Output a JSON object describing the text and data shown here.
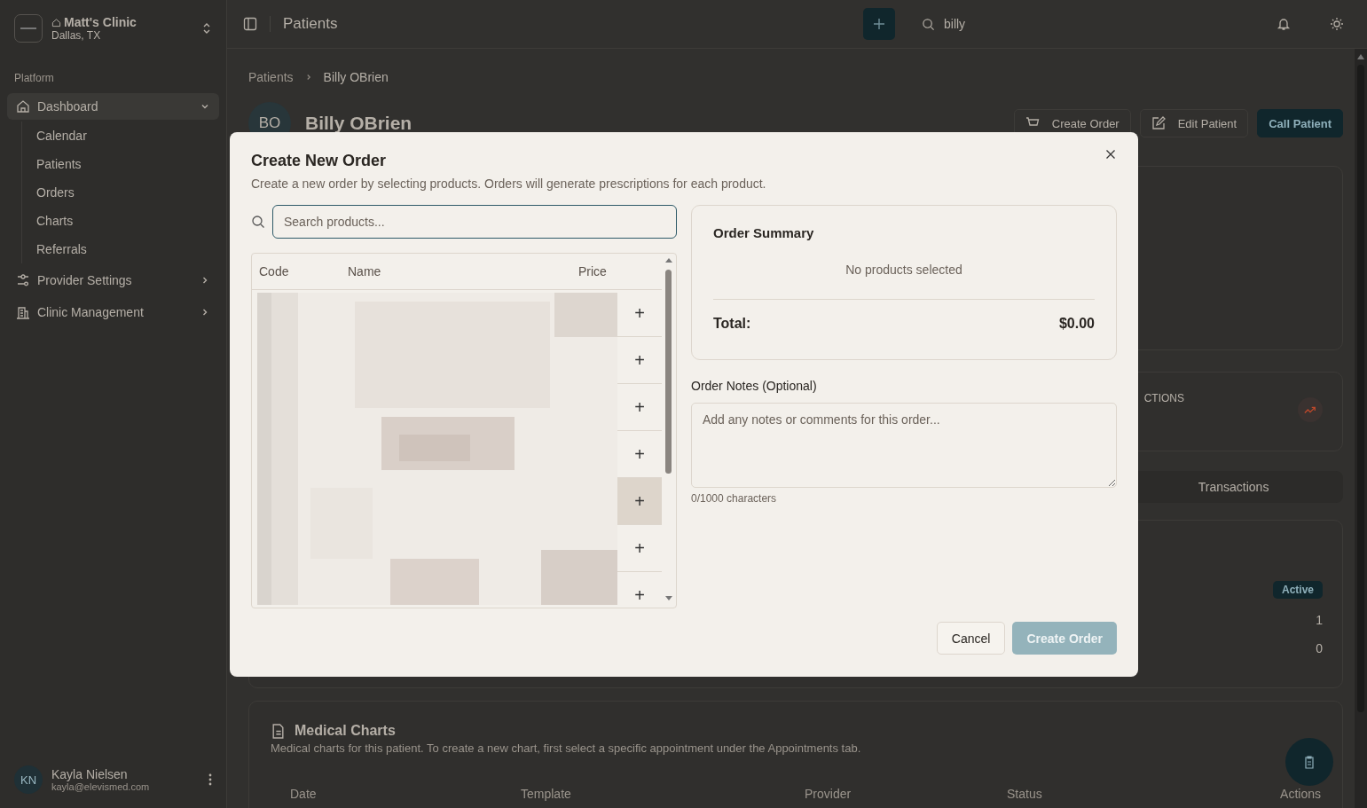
{
  "sidebar": {
    "clinic": {
      "name": "Matt's Clinic",
      "location": "Dallas, TX"
    },
    "section_label": "Platform",
    "nav": [
      {
        "label": "Dashboard",
        "kind": "home",
        "expanded": true,
        "selected": true,
        "children": [
          {
            "label": "Calendar"
          },
          {
            "label": "Patients"
          },
          {
            "label": "Orders"
          },
          {
            "label": "Charts"
          },
          {
            "label": "Referrals"
          }
        ]
      },
      {
        "label": "Provider Settings",
        "kind": "sliders",
        "expanded": false,
        "selected": false
      },
      {
        "label": "Clinic Management",
        "kind": "building",
        "expanded": false,
        "selected": false
      }
    ],
    "user": {
      "initials": "KN",
      "name": "Kayla Nielsen",
      "email": "kayla@elevismed.com"
    }
  },
  "header": {
    "title": "Patients",
    "search": {
      "value": "billy"
    }
  },
  "breadcrumb": [
    "Patients",
    "Billy OBrien"
  ],
  "patient": {
    "initials": "BO",
    "name": "Billy OBrien",
    "actions": [
      {
        "label": "Create Order",
        "kind": "cart"
      },
      {
        "label": "Edit Patient",
        "kind": "edit"
      },
      {
        "label": "Call Patient",
        "kind": "primary"
      }
    ]
  },
  "background": {
    "stat_label": "CTIONS",
    "tab": "Transactions",
    "status_badge": "Active",
    "values": [
      "1",
      "0"
    ]
  },
  "medical_charts": {
    "title": "Medical Charts",
    "description": "Medical charts for this patient. To create a new chart, first select a specific appointment under the Appointments tab.",
    "columns": [
      "Date",
      "Template",
      "Provider",
      "Status",
      "Actions"
    ]
  },
  "dialog": {
    "title": "Create New Order",
    "description": "Create a new order by selecting products. Orders will generate prescriptions for each product.",
    "search": {
      "placeholder": "Search products..."
    },
    "columns": [
      "Code",
      "Name",
      "Price"
    ],
    "rows": [
      {
        "add": "+",
        "highlighted": false
      },
      {
        "add": "+",
        "highlighted": false
      },
      {
        "add": "+",
        "highlighted": false
      },
      {
        "add": "+",
        "highlighted": false
      },
      {
        "add": "+",
        "highlighted": true
      },
      {
        "add": "+",
        "highlighted": false
      },
      {
        "add": "+",
        "highlighted": false
      }
    ],
    "summary": {
      "title": "Order Summary",
      "empty": "No products selected",
      "total_label": "Total:",
      "total": "$0.00"
    },
    "notes": {
      "label": "Order Notes (Optional)",
      "placeholder": "Add any notes or comments for this order...",
      "counter": "0/1000 characters"
    },
    "buttons": [
      {
        "label": "Cancel",
        "kind": "secondary",
        "disabled": false
      },
      {
        "label": "Create Order",
        "kind": "primary",
        "disabled": true
      }
    ]
  }
}
